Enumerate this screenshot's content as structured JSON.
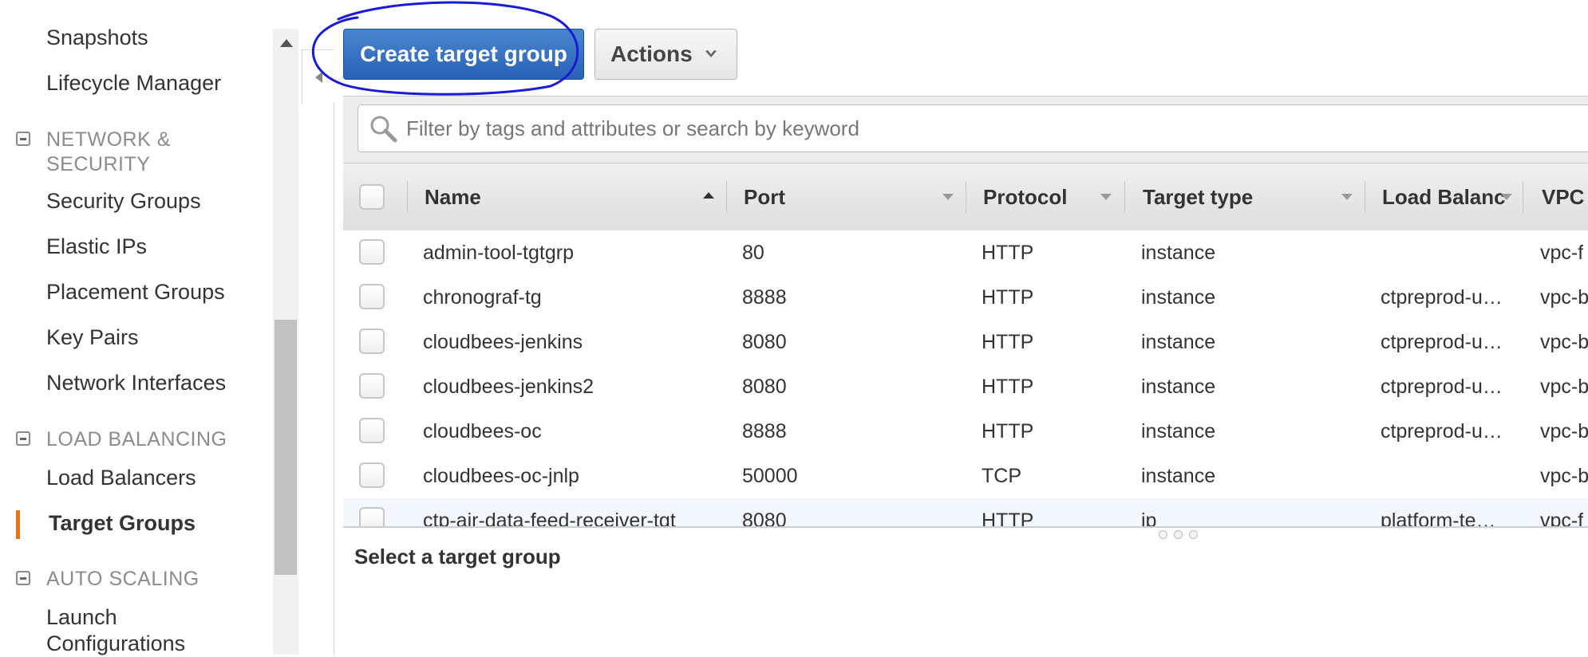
{
  "sidebar": {
    "top_items": [
      "Snapshots",
      "Lifecycle Manager"
    ],
    "sections": [
      {
        "title": "NETWORK & SECURITY",
        "items": [
          "Security Groups",
          "Elastic IPs",
          "Placement Groups",
          "Key Pairs",
          "Network Interfaces"
        ]
      },
      {
        "title": "LOAD BALANCING",
        "items": [
          "Load Balancers",
          "Target Groups"
        ]
      },
      {
        "title": "AUTO SCALING",
        "items": [
          "Launch Configurations"
        ]
      }
    ],
    "active_item": "Target Groups"
  },
  "toolbar": {
    "create_label": "Create target group",
    "actions_label": "Actions"
  },
  "search": {
    "placeholder": "Filter by tags and attributes or search by keyword"
  },
  "table": {
    "columns": [
      "Name",
      "Port",
      "Protocol",
      "Target type",
      "Load Balanc",
      "VPC"
    ],
    "rows": [
      {
        "name": "admin-tool-tgtgrp",
        "port": "80",
        "protocol": "HTTP",
        "target_type": "instance",
        "load_balancer": "",
        "vpc": "vpc-f"
      },
      {
        "name": "chronograf-tg",
        "port": "8888",
        "protocol": "HTTP",
        "target_type": "instance",
        "load_balancer": "ctpreprod-u…",
        "vpc": "vpc-b"
      },
      {
        "name": "cloudbees-jenkins",
        "port": "8080",
        "protocol": "HTTP",
        "target_type": "instance",
        "load_balancer": "ctpreprod-u…",
        "vpc": "vpc-b"
      },
      {
        "name": "cloudbees-jenkins2",
        "port": "8080",
        "protocol": "HTTP",
        "target_type": "instance",
        "load_balancer": "ctpreprod-u…",
        "vpc": "vpc-b"
      },
      {
        "name": "cloudbees-oc",
        "port": "8888",
        "protocol": "HTTP",
        "target_type": "instance",
        "load_balancer": "ctpreprod-u…",
        "vpc": "vpc-b"
      },
      {
        "name": "cloudbees-oc-jnlp",
        "port": "50000",
        "protocol": "TCP",
        "target_type": "instance",
        "load_balancer": "",
        "vpc": "vpc-b"
      },
      {
        "name": "ctp-air-data-feed-receiver-tgt",
        "port": "8080",
        "protocol": "HTTP",
        "target_type": "ip",
        "load_balancer": "platform-te…",
        "vpc": "vpc-f"
      }
    ]
  },
  "detail": {
    "title": "Select a target group"
  },
  "colors": {
    "primary_button": "#2861b7",
    "active_indicator": "#ec7211",
    "annotation_ink": "#1a1adb"
  }
}
